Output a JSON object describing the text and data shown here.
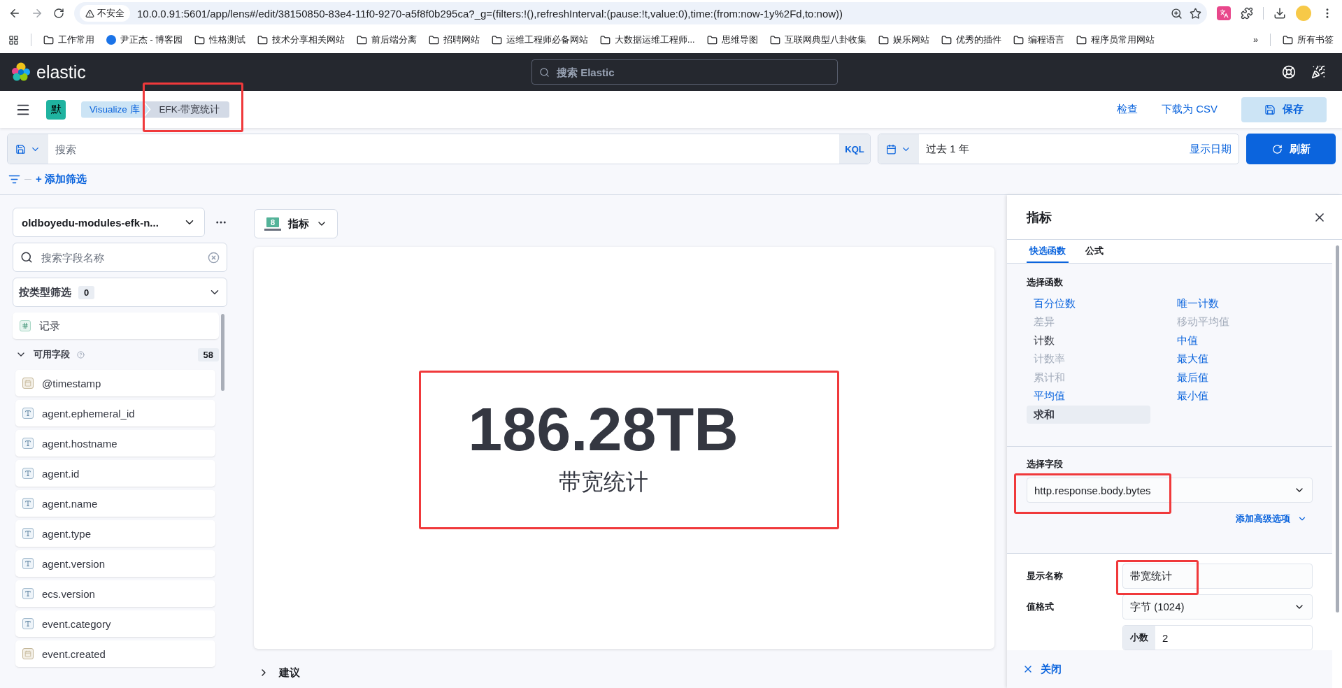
{
  "browser": {
    "security": "不安全",
    "url": "10.0.0.91:5601/app/lens#/edit/38150850-83e4-11f0-9270-a5f8f0b295ca?_g=(filters:!(),refreshInterval:(pause:!t,value:0),time:(from:now-1y%2Fd,to:now))",
    "bookmarks": [
      {
        "label": "工作常用",
        "kind": "folder"
      },
      {
        "label": "尹正杰 - 博客园",
        "kind": "site"
      },
      {
        "label": "性格测试",
        "kind": "folder"
      },
      {
        "label": "技术分享相关网站",
        "kind": "folder"
      },
      {
        "label": "前后端分离",
        "kind": "folder"
      },
      {
        "label": "招聘网站",
        "kind": "folder"
      },
      {
        "label": "运维工程师必备网站",
        "kind": "folder"
      },
      {
        "label": "大数据运维工程师...",
        "kind": "folder"
      },
      {
        "label": "思维导图",
        "kind": "folder"
      },
      {
        "label": "互联网典型八卦收集",
        "kind": "folder"
      },
      {
        "label": "娱乐网站",
        "kind": "folder"
      },
      {
        "label": "优秀的插件",
        "kind": "folder"
      },
      {
        "label": "编程语言",
        "kind": "folder"
      },
      {
        "label": "程序员常用网站",
        "kind": "folder"
      }
    ],
    "overflow": "»",
    "all_bookmarks": "所有书签"
  },
  "header": {
    "brand": "elastic",
    "search": {
      "placeholder": "搜索 Elastic"
    }
  },
  "toolbar": {
    "space_avatar": "默",
    "breadcrumbs": [
      {
        "label": "Visualize 库",
        "current": false,
        "highlighted": false
      },
      {
        "label": "EFK-带宽统计",
        "current": true,
        "highlighted": true
      }
    ],
    "actions": [
      "检查",
      "下载为 CSV"
    ],
    "save": "保存"
  },
  "query": {
    "placeholder": "搜索",
    "language": "KQL",
    "time": "过去 1 年",
    "show_dates": "显示日期",
    "refresh": "刷新",
    "add_filter": "+ 添加筛选"
  },
  "sidebar": {
    "data_view": "oldboyedu-modules-efk-n...",
    "field_search": {
      "placeholder": "搜索字段名称"
    },
    "type_filter": {
      "label": "按类型筛选",
      "count": "0"
    },
    "records": {
      "label": "记录",
      "kind": "number"
    },
    "available": {
      "label": "可用字段",
      "count": "58",
      "expanded": true
    },
    "fields": [
      {
        "name": "@timestamp",
        "kind": "date"
      },
      {
        "name": "agent.ephemeral_id",
        "kind": "string"
      },
      {
        "name": "agent.hostname",
        "kind": "string"
      },
      {
        "name": "agent.id",
        "kind": "string"
      },
      {
        "name": "agent.name",
        "kind": "string"
      },
      {
        "name": "agent.type",
        "kind": "string"
      },
      {
        "name": "agent.version",
        "kind": "string"
      },
      {
        "name": "ecs.version",
        "kind": "string"
      },
      {
        "name": "event.category",
        "kind": "string"
      },
      {
        "name": "event.created",
        "kind": "date"
      }
    ]
  },
  "workspace": {
    "chart_type": {
      "icon_text": "8",
      "label": "指标"
    },
    "metric": {
      "value": "186.28TB",
      "label": "带宽统计",
      "highlighted": true
    },
    "suggestions": {
      "label": "建议",
      "expanded": false
    }
  },
  "flyout": {
    "title": "指标",
    "tabs": [
      {
        "label": "快选函数",
        "selected": true
      },
      {
        "label": "公式",
        "selected": false
      }
    ],
    "functions_label": "选择函数",
    "functions": [
      {
        "label": "百分位数",
        "kind": "link",
        "disabled": false,
        "selected": false
      },
      {
        "label": "差异",
        "kind": "link",
        "disabled": true,
        "selected": false
      },
      {
        "label": "计数",
        "kind": "plain",
        "disabled": false,
        "selected": false
      },
      {
        "label": "计数率",
        "kind": "link",
        "disabled": true,
        "selected": false
      },
      {
        "label": "累计和",
        "kind": "link",
        "disabled": true,
        "selected": false
      },
      {
        "label": "平均值",
        "kind": "link",
        "disabled": false,
        "selected": false
      },
      {
        "label": "求和",
        "kind": "plain",
        "disabled": false,
        "selected": true
      },
      {
        "label": "唯一计数",
        "kind": "link",
        "disabled": false,
        "selected": false
      },
      {
        "label": "移动平均值",
        "kind": "link",
        "disabled": true,
        "selected": false
      },
      {
        "label": "中值",
        "kind": "link",
        "disabled": false,
        "selected": false
      },
      {
        "label": "最大值",
        "kind": "link",
        "disabled": false,
        "selected": false
      },
      {
        "label": "最后值",
        "kind": "link",
        "disabled": false,
        "selected": false
      },
      {
        "label": "最小值",
        "kind": "link",
        "disabled": false,
        "selected": false
      }
    ],
    "field_label": "选择字段",
    "field": {
      "value": "http.response.body.bytes",
      "highlighted": true
    },
    "advanced": "添加高级选项",
    "name_label": "显示名称",
    "name": {
      "value": "带宽统计",
      "highlighted": true
    },
    "format_label": "值格式",
    "format": "字节 (1024)",
    "decimals": {
      "label": "小数",
      "value": "2"
    },
    "close": "关闭"
  }
}
